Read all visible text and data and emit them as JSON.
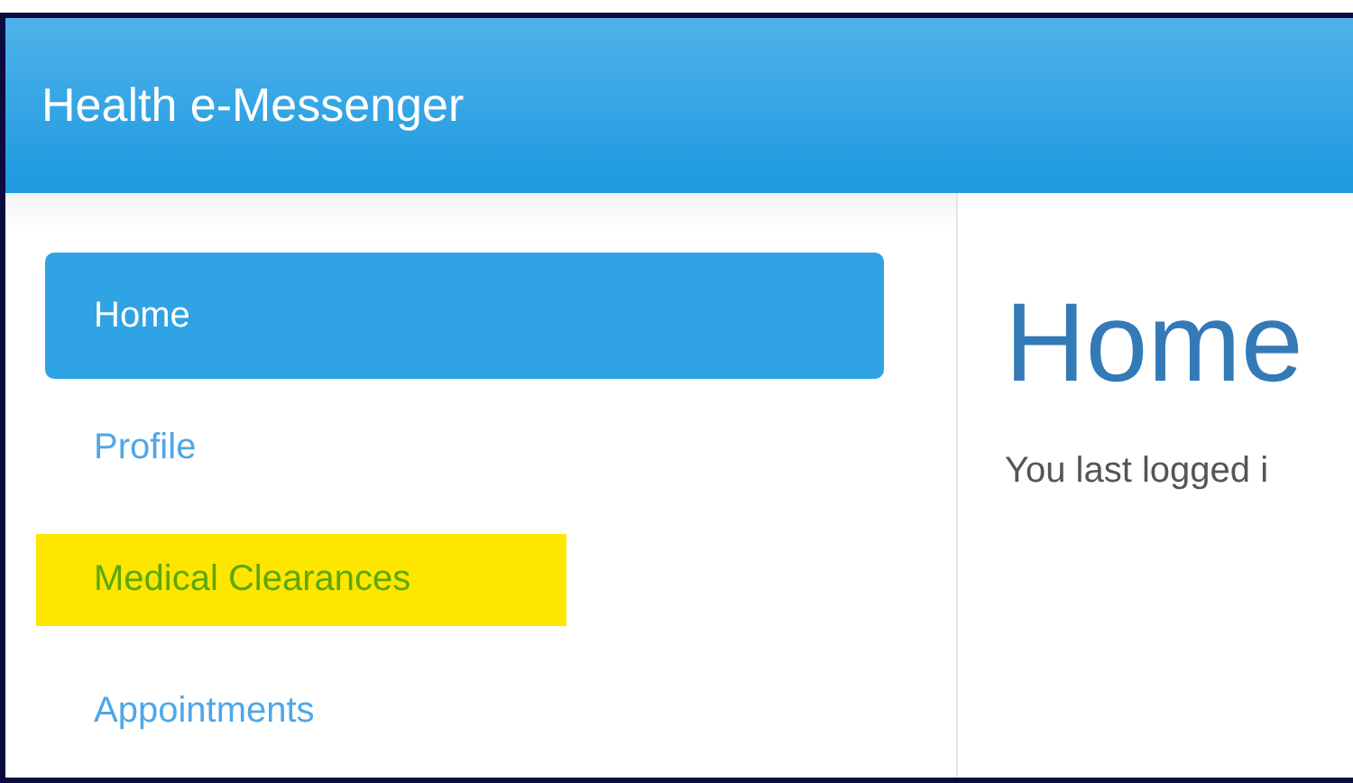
{
  "header": {
    "title": "Health e-Messenger"
  },
  "sidebar": {
    "items": [
      {
        "label": "Home",
        "selected": true,
        "highlighted": false
      },
      {
        "label": "Profile",
        "selected": false,
        "highlighted": false
      },
      {
        "label": "Medical Clearances",
        "selected": false,
        "highlighted": true
      },
      {
        "label": "Appointments",
        "selected": false,
        "highlighted": false
      }
    ]
  },
  "content": {
    "heading": "Home",
    "text": "You last logged i"
  }
}
